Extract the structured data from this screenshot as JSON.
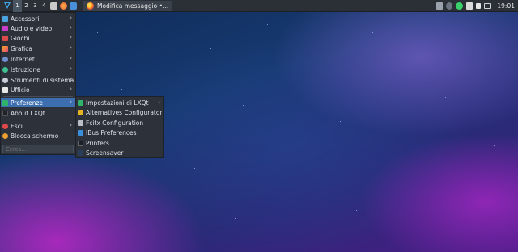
{
  "taskbar": {
    "desktops": [
      "1",
      "2",
      "3",
      "4"
    ],
    "active_desktop": "1",
    "task_title": "Modifica messaggio •...",
    "clock": "19:01",
    "colors": {
      "bar": "#2b3037",
      "highlight": "#3d6fb0"
    }
  },
  "main_menu": {
    "items": [
      {
        "label": "Accessori",
        "icon": "accessories-icon",
        "submenu": true
      },
      {
        "label": "Audio e video",
        "icon": "multimedia-icon",
        "submenu": true
      },
      {
        "label": "Giochi",
        "icon": "games-icon",
        "submenu": true
      },
      {
        "label": "Grafica",
        "icon": "graphics-icon",
        "submenu": true
      },
      {
        "label": "Internet",
        "icon": "internet-icon",
        "submenu": true
      },
      {
        "label": "Istruzione",
        "icon": "education-icon",
        "submenu": true
      },
      {
        "label": "Strumenti di sistema",
        "icon": "system-tools-icon",
        "submenu": true
      },
      {
        "label": "Ufficio",
        "icon": "office-icon",
        "submenu": true
      },
      {
        "label": "Preferenze",
        "icon": "preferences-icon",
        "submenu": true,
        "active": true
      },
      {
        "label": "About LXQt",
        "icon": "about-icon",
        "submenu": false
      },
      {
        "label": "Esci",
        "icon": "leave-icon",
        "submenu": true
      },
      {
        "label": "Blocca schermo",
        "icon": "lock-screen-icon",
        "submenu": false
      }
    ],
    "search_placeholder": "Cerca..."
  },
  "preferences_submenu": {
    "items": [
      {
        "label": "Impostazioni di LXQt",
        "icon": "lxqt-settings-icon",
        "submenu": true
      },
      {
        "label": "Alternatives Configurator",
        "icon": "alternatives-icon",
        "submenu": false
      },
      {
        "label": "Fcitx Configuration",
        "icon": "keyboard-icon",
        "submenu": false
      },
      {
        "label": "IBus Preferences",
        "icon": "ibus-icon",
        "submenu": false
      },
      {
        "label": "Printers",
        "icon": "printer-icon",
        "submenu": false
      },
      {
        "label": "Screensaver",
        "icon": "screensaver-icon",
        "submenu": false
      }
    ]
  }
}
